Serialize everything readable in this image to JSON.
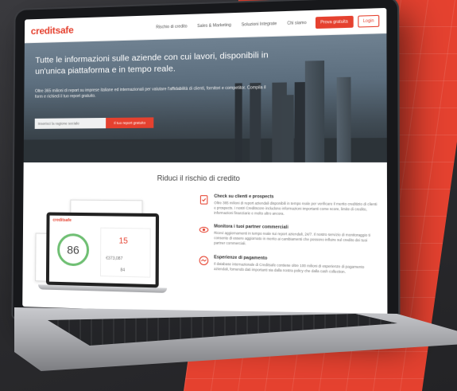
{
  "nav": {
    "logo": "creditsafe",
    "links": [
      "Rischio di credito",
      "Sales & Marketing",
      "Soluzioni Integrate",
      "Chi siamo"
    ],
    "trial_button": "Prova gratuita",
    "login_button": "Login"
  },
  "hero": {
    "title": "Tutte le informazioni sulle aziende con cui lavori, disponibili in un'unica piattaforma e in tempo reale.",
    "subtitle": "Oltre 365 milioni di report su imprese italiane ed internazionali per valutare l'affidabilità di clienti, fornitori e competitor. Compila il form e richiedi il tuo report gratuito.",
    "search_placeholder": "Inserisci la ragione sociale",
    "search_button": "Il tuo report gratuito"
  },
  "section": {
    "title": "Riduci il rischio di credito"
  },
  "illustration": {
    "logo": "creditsafe",
    "score": "86",
    "card_number": "15",
    "card_amount": "€373,087",
    "card_small": "84"
  },
  "features": [
    {
      "icon": "checklist-icon",
      "title": "Check su clienti e prospects",
      "text": "Oltre 365 milioni di report aziendali disponibili in tempo reale per verificare il merito creditizio di clienti e prospects. I nostri Creditscore includono informazioni importanti come score, limite di credito, informazioni finanziarie e molto altro ancora."
    },
    {
      "icon": "eye-icon",
      "title": "Monitora i tuoi partner commerciali",
      "text": "Ricevi aggiornamenti in tempo reale sui report aziendali, 24/7. Il nostro servizio di monitoraggio ti consente di essere aggiornato in merito ai cambiamenti che possono influire sul credito dei tuoi partner commerciali."
    },
    {
      "icon": "handshake-icon",
      "title": "Esperienze di pagamento",
      "text": "Il database internazionale di Creditsafe contiene oltre 100 milioni di esperienze di pagamento aziendali, fornendo dati importanti sia dalla nostra policy che dalla cash collection."
    }
  ],
  "colors": {
    "brand": "#e5412f",
    "gauge": "#6fbf73"
  }
}
